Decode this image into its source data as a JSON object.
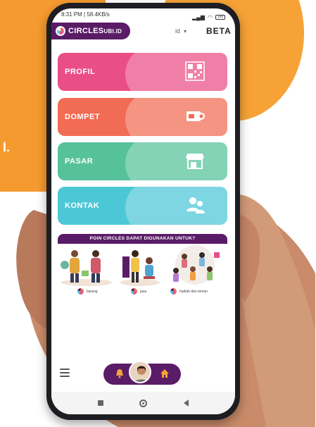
{
  "status": {
    "time_info": "8:31 PM | 58.4KB/s",
    "battery": "100"
  },
  "appbar": {
    "brand_main": "CIRCLES",
    "brand_suffix": "UBI.ID",
    "lang": "id",
    "beta": "BETA"
  },
  "menu": [
    {
      "label": "PROFIL",
      "icon": "qr-code-icon"
    },
    {
      "label": "DOMPET",
      "icon": "wallet-icon"
    },
    {
      "label": "PASAR",
      "icon": "store-icon"
    },
    {
      "label": "KONTAK",
      "icon": "contacts-icon"
    }
  ],
  "info": {
    "banner": "POIN CIRCLES DAPAT DIGUNAKAN UNTUK?",
    "captions": [
      "barang",
      "jasa",
      "hadiah dan teman"
    ]
  },
  "background": {
    "dot_text": "l."
  },
  "colors": {
    "brand_purple": "#5a1c66",
    "profil": "#ea4e86",
    "dompet": "#f26b54",
    "pasar": "#55c29b",
    "kontak": "#4cc7d6",
    "accent_orange": "#f59a2e"
  }
}
